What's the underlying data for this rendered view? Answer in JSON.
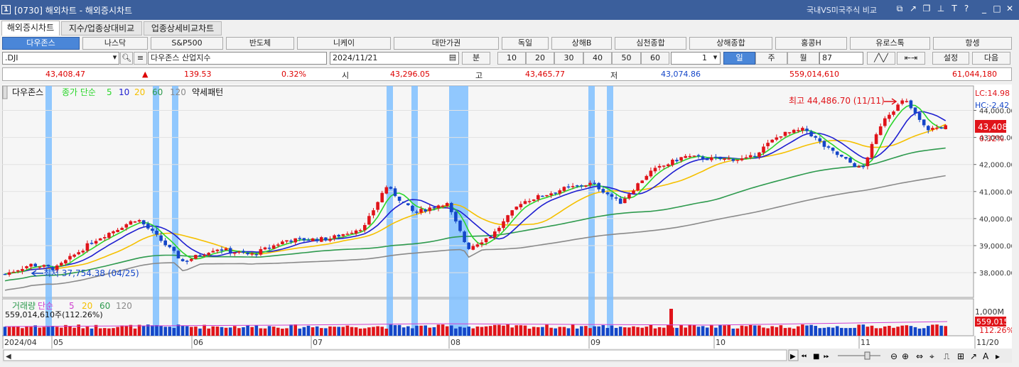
{
  "window": {
    "title": "[0730] 해외차트 - 해외증시차트",
    "right_label": "국내VS미국주식 비교"
  },
  "tabs": [
    "해외증시차트",
    "지수/업종상대비교",
    "업종상세비교차트"
  ],
  "markets": [
    "다우존스",
    "나스닥",
    "S&P500",
    "반도체",
    "니케이",
    "대만가권",
    "독일",
    "상해B",
    "심천종합",
    "상해종합",
    "홍콩H",
    "유로스톡",
    "항셍"
  ],
  "controls": {
    "code": ".DJI",
    "name": "다우존스 산업지수",
    "date": "2024/11/21",
    "min_label": "분",
    "minutes": [
      "10",
      "20",
      "30",
      "40",
      "50",
      "60"
    ],
    "count_sel": "1",
    "period": [
      "일",
      "주",
      "월"
    ],
    "count": "87",
    "settings": "설정",
    "next": "다음"
  },
  "quote": {
    "price": "43,408.47",
    "change": "139.53",
    "pct": "0.32%",
    "open_label": "시",
    "open": "43,296.05",
    "high_label": "고",
    "high": "43,465.77",
    "low_label": "저",
    "low": "43,074.86",
    "volume": "559,014,610",
    "amount": "61,044,180"
  },
  "chart": {
    "legend": {
      "name": "다우존스",
      "ma_label": "종가 단순",
      "ma": [
        "5",
        "10",
        "20",
        "60",
        "120"
      ],
      "pattern": "약세패턴"
    },
    "vol_legend": {
      "name": "거래량",
      "ma_label": "단순",
      "ma": [
        "5",
        "20",
        "60",
        "120"
      ],
      "value": "559,014,610주(112.26%)"
    },
    "max_label": "최고 44,486.70 (11/11)",
    "min_label": "최저 37,754.38 (04/25)",
    "lc": "LC:14.98",
    "hc": "HC:-2.42",
    "y_ticks": [
      "44,000.00",
      "43,000.00",
      "42,000.00",
      "41,000.00",
      "40,000.00",
      "39,000.00",
      "38,000.00"
    ],
    "price_tag": "43,408",
    "pct_tag": "0.32%",
    "vol_ticks": [
      "1,000M"
    ],
    "vol_tag": "559,015",
    "vol_pct_tag": "112.26%",
    "x_labels": [
      "2024/04",
      "05",
      "06",
      "07",
      "08",
      "09",
      "10",
      "11",
      "11/20"
    ],
    "colors": {
      "up": "#e0141a",
      "down": "#1446c8",
      "ma5": "#2bd62b",
      "ma10": "#1e1ed0",
      "ma20": "#f5c000",
      "ma60": "#2e9a4e",
      "ma120": "#8a8a8a",
      "highlight": "#7fc0ff"
    }
  }
}
